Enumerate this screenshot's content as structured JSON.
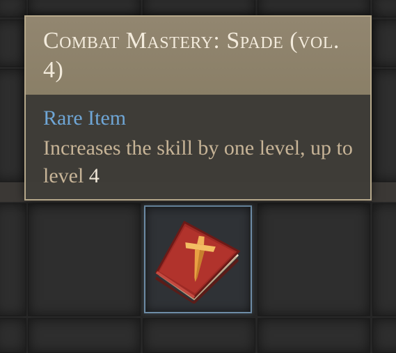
{
  "tooltip": {
    "title": "Combat Mastery: Spade (vol. 4)",
    "rarity": "Rare Item",
    "description_prefix": "Increases the skill by one level, up to level ",
    "description_level": "4"
  },
  "colors": {
    "rarity_rare": "#6fa6d6",
    "tooltip_border": "#b7a98b",
    "slot_highlight": "#6d8ca6"
  },
  "inventory": {
    "selected_item_icon": "red-skill-book-icon"
  }
}
